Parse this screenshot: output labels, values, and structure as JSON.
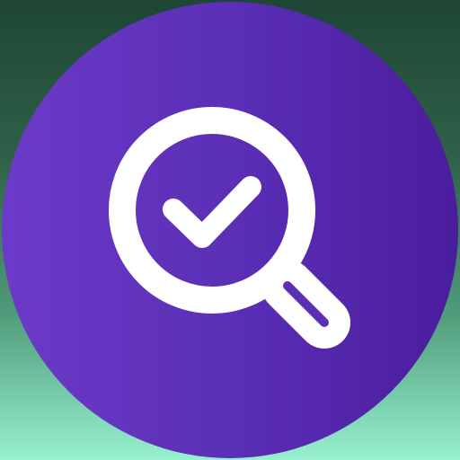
{
  "app_icon": {
    "icon": "search-check-icon",
    "background_colors": {
      "top": "#1f4535",
      "bottom": "#97f0cf"
    },
    "badge_colors": {
      "left": "#6c3ac9",
      "right": "#4a1d9e"
    },
    "glyph_color": "#ffffff"
  }
}
